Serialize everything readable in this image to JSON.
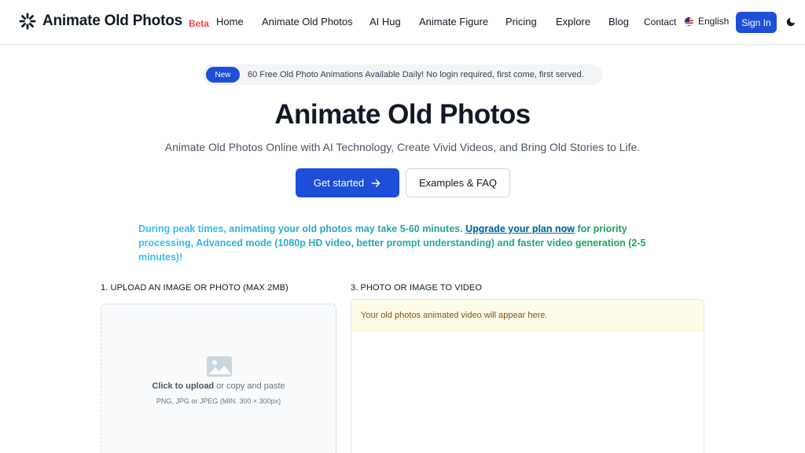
{
  "header": {
    "logo_text": "Animate Old Photos",
    "beta_label": "Beta",
    "nav": [
      {
        "label": "Home"
      },
      {
        "label": "Animate Old Photos"
      },
      {
        "label": "AI Hug"
      },
      {
        "label": "Animate Figure"
      },
      {
        "label": "Pricing"
      },
      {
        "label": "Explore"
      },
      {
        "label": "Blog"
      }
    ],
    "contact_label": "Contact",
    "language_label": "English",
    "signin_label": "Sign In",
    "theme_icon": "moon-icon"
  },
  "announcement": {
    "badge": "New",
    "text": "60 Free Old Photo Animations Available Daily! No login required, first come, first served."
  },
  "hero": {
    "title": "Animate Old Photos",
    "subtitle": "Animate Old Photos Online with AI Technology, Create Vivid Videos, and Bring Old Stories to Life.",
    "primary_button": "Get started",
    "secondary_button": "Examples & FAQ"
  },
  "notice": {
    "before_link": "During peak times, animating your old photos may take 5-60 minutes. ",
    "link_text": "Upgrade your plan now",
    "after_link": " for priority processing, Advanced mode (1080p HD video, better prompt understanding) and faster video generation (2-5 minutes)!"
  },
  "upload_section": {
    "label": "1. UPLOAD AN IMAGE OR PHOTO (MAX 2MB)",
    "click_text": "Click to upload",
    "or_text": " or copy and paste",
    "hint": "PNG, JPG or JPEG (MIN. 300 × 300px)"
  },
  "video_section": {
    "label": "3. PHOTO OR IMAGE TO VIDEO",
    "placeholder": "Your old photos animated video will appear here."
  },
  "colors": {
    "primary": "#1d4ed8",
    "beta": "#ef4444",
    "notice_start": "#38bdf8",
    "notice_end": "#16a34a",
    "video_note_bg": "#fefce8"
  }
}
